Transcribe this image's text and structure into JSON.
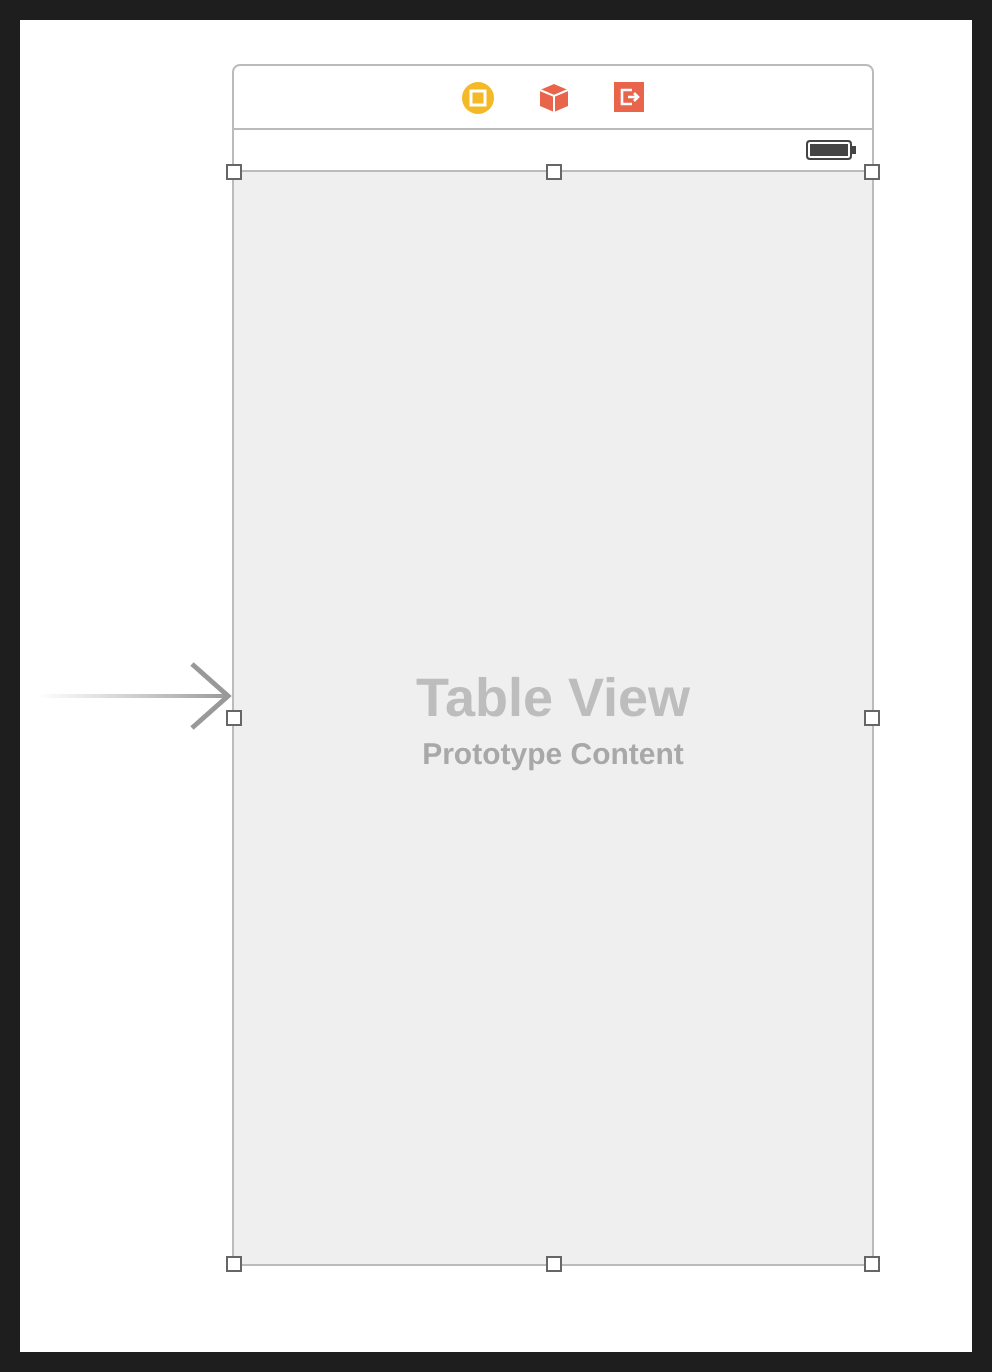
{
  "table_view": {
    "title": "Table View",
    "subtitle": "Prototype Content",
    "selected": true
  }
}
